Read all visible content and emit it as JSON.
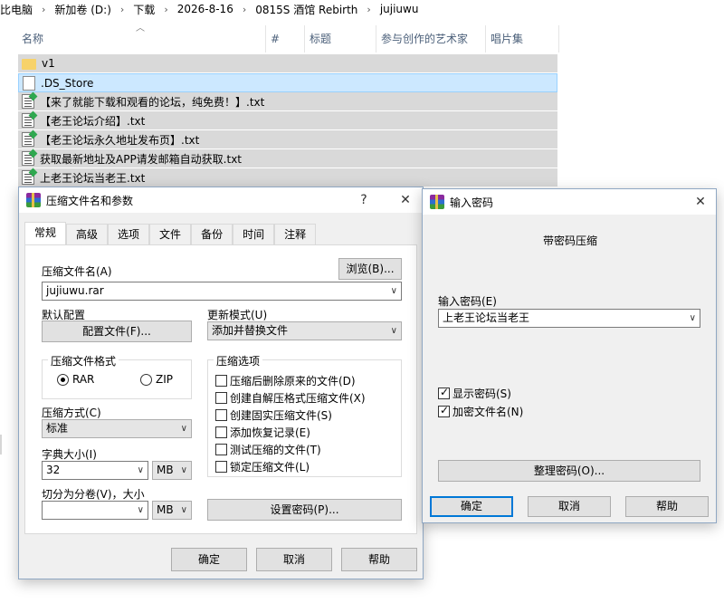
{
  "explorer": {
    "breadcrumb": [
      "比电脑",
      "新加卷 (D:)",
      "下载",
      "2026-8-16",
      "0815S 酒馆 Rebirth",
      "jujiuwu"
    ],
    "columns": [
      "名称",
      "#",
      "标题",
      "参与创作的艺术家",
      "唱片集"
    ],
    "files": [
      {
        "name": "v1",
        "icon": "folder-icon"
      },
      {
        "name": ".DS_Store",
        "icon": "file-icon"
      },
      {
        "name": "【来了就能下载和观看的论坛，纯免费！】.txt",
        "icon": "text-file-icon"
      },
      {
        "name": "【老王论坛介绍】.txt",
        "icon": "text-file-icon"
      },
      {
        "name": "【老王论坛永久地址发布页】.txt",
        "icon": "text-file-icon"
      },
      {
        "name": "获取最新地址及APP请发邮箱自动获取.txt",
        "icon": "text-file-icon"
      },
      {
        "name": "上老王论坛当老王.txt",
        "icon": "text-file-icon"
      }
    ]
  },
  "archive_dialog": {
    "title": "压缩文件名和参数",
    "help_btn": "?",
    "close_btn": "✕",
    "tabs": [
      "常规",
      "高级",
      "选项",
      "文件",
      "备份",
      "时间",
      "注释"
    ],
    "archive_name_label": "压缩文件名(A)",
    "browse_btn": "浏览(B)...",
    "archive_name_value": "jujiuwu.rar",
    "default_config_label": "默认配置",
    "profiles_btn": "配置文件(F)...",
    "update_mode_label": "更新模式(U)",
    "update_mode_value": "添加并替换文件",
    "format_group": "压缩文件格式",
    "format_rar": "RAR",
    "format_zip": "ZIP",
    "options_group": "压缩选项",
    "options": [
      {
        "label": "压缩后删除原来的文件(D)",
        "checked": false
      },
      {
        "label": "创建自解压格式压缩文件(X)",
        "checked": false
      },
      {
        "label": "创建固实压缩文件(S)",
        "checked": false
      },
      {
        "label": "添加恢复记录(E)",
        "checked": false
      },
      {
        "label": "测试压缩的文件(T)",
        "checked": false
      },
      {
        "label": "锁定压缩文件(L)",
        "checked": false
      }
    ],
    "method_label": "压缩方式(C)",
    "method_value": "标准",
    "dict_label": "字典大小(I)",
    "dict_value": "32",
    "dict_unit": "MB",
    "split_label": "切分为分卷(V)，大小",
    "split_value": "",
    "split_unit": "MB",
    "set_password_btn": "设置密码(P)...",
    "ok_btn": "确定",
    "cancel_btn": "取消",
    "help_footer_btn": "帮助"
  },
  "password_dialog": {
    "title": "输入密码",
    "close_btn": "✕",
    "heading": "带密码压缩",
    "enter_label": "输入密码(E)",
    "password_value": "上老王论坛当老王",
    "show_password": "显示密码(S)",
    "show_password_checked": true,
    "encrypt_names": "加密文件名(N)",
    "encrypt_names_checked": true,
    "organize_btn": "整理密码(O)...",
    "ok_btn": "确定",
    "cancel_btn": "取消",
    "help_btn": "帮助"
  }
}
